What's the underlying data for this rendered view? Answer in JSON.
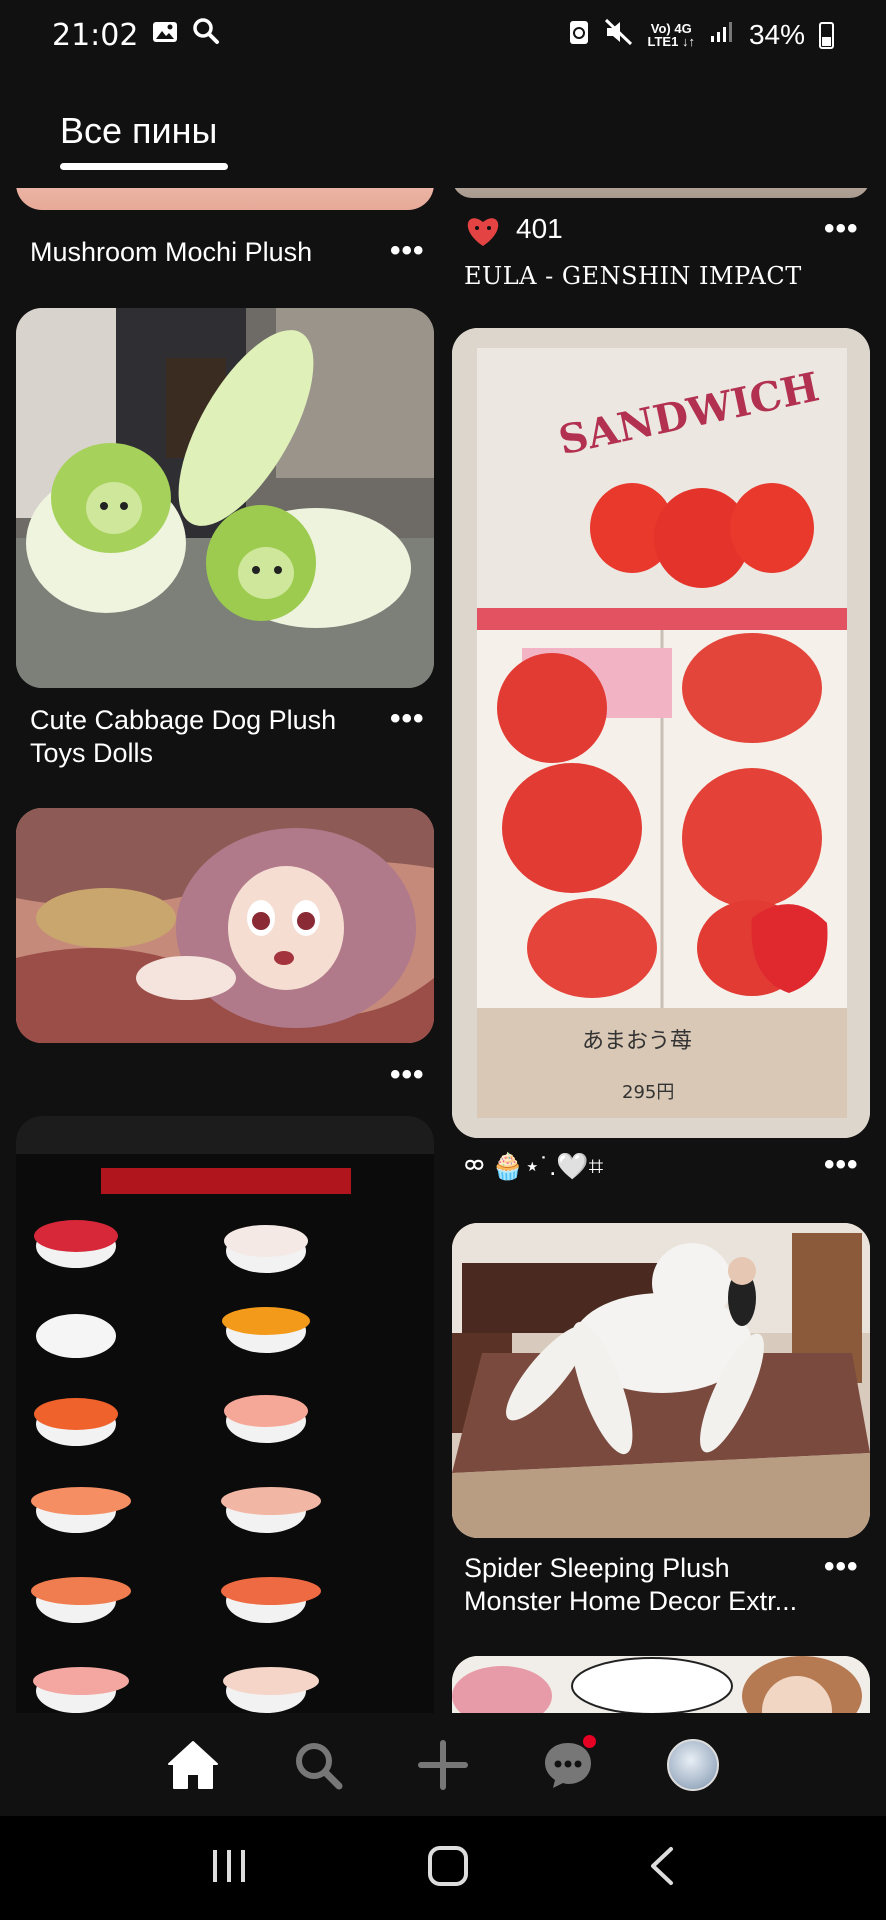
{
  "status_bar": {
    "time": "21:02",
    "network_line1": "Vo) 4G",
    "network_line2": "LTE1 ↓↑",
    "battery": "34%"
  },
  "header": {
    "tab_label": "Все пины"
  },
  "pins": {
    "left": [
      {
        "title": "Mushroom Mochi Plush"
      },
      {
        "title_line1": "Cute Cabbage Dog Plush",
        "title_line2": "Toys Dolls"
      },
      {
        "title": ""
      },
      {
        "title": ""
      }
    ],
    "right": [
      {
        "likes": "401",
        "title": "EULA - GENSHIN IMPACT"
      },
      {
        "title": "ᢁ 🧁⋆˙.🤍⌗"
      },
      {
        "title_line1": "Spider Sleeping Plush",
        "title_line2": "Monster Home Decor Extr..."
      },
      {
        "title": ""
      }
    ]
  },
  "more_glyph": "•••",
  "bottom_nav": {
    "items": [
      "home",
      "search",
      "create",
      "messages",
      "profile"
    ],
    "active": "home"
  },
  "colors": {
    "background": "#111111",
    "accent_red": "#e60023",
    "text": "#ffffff"
  }
}
